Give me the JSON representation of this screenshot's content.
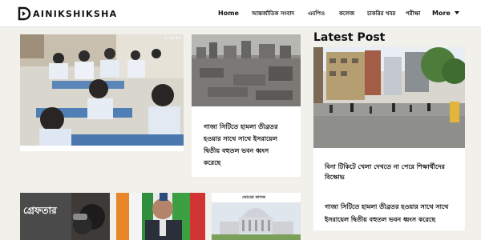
{
  "header": {
    "logo_text": "AINIKSHIKSHA",
    "logo_icon": "logo-d-mark",
    "nav": [
      {
        "label": "Home"
      },
      {
        "label": "আন্তর্জাতিক সংবাদ"
      },
      {
        "label": "এমপিও"
      },
      {
        "label": "কলেজ"
      },
      {
        "label": "চাকরির খবর"
      },
      {
        "label": "পরীক্ষা"
      },
      {
        "label": "More",
        "icon": "chevron-down-icon"
      }
    ]
  },
  "main": {
    "gaza_headline": "গাজা সিটিতে হামলা তীব্রতর হওয়ার সাথে সাথে ইসরায়েল দ্বিতীয় বহুতল ভবন ধ্বংস করেছে",
    "photo_credit": "© Dai Bak",
    "arrest_caption": "গ্রেফতার",
    "parliament_caption": "ভোরের কাগজ"
  },
  "sidebar": {
    "title": "Latest Post",
    "featured_headline": "বিনা টিকিটে খেলা দেখতে না পেরে শিক্ষার্থীদের বিক্ষোভ",
    "list": [
      {
        "text": "গাজা সিটিতে হামলা তীব্রতর হওয়ার সাথে সাথে ইসরায়েল দ্বিতীয় বহুতল ভবন ধ্বংস করেছে"
      }
    ]
  },
  "colors": {
    "page_bg": "#f1f0ea",
    "card_bg": "#ffffff",
    "text": "#111111"
  }
}
